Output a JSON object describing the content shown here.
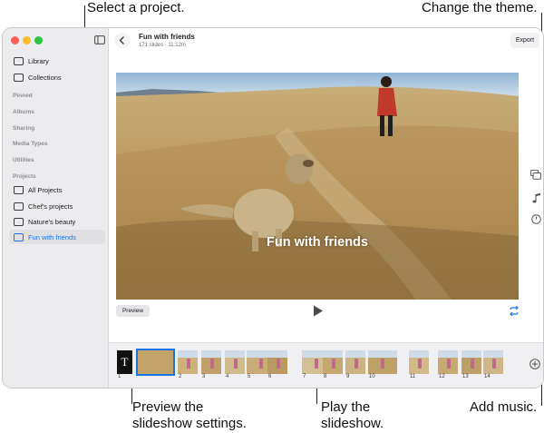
{
  "callouts": {
    "select_project": "Select a project.",
    "change_theme": "Change the theme.",
    "preview_line1": "Preview the",
    "preview_line2": "slideshow settings.",
    "play_line1": "Play the",
    "play_line2": "slideshow.",
    "add_music": "Add music."
  },
  "sidebar": {
    "top_items": [
      {
        "label": "Library",
        "icon": "photo-library-icon"
      },
      {
        "label": "Collections",
        "icon": "collections-icon"
      }
    ],
    "sections": [
      "Pinned",
      "Albums",
      "Sharing",
      "Media Types",
      "Utilities",
      "Projects"
    ],
    "projects": [
      {
        "label": "All Projects",
        "icon": "projects-icon",
        "active": false
      },
      {
        "label": "Chef's projects",
        "icon": "slideshow-icon",
        "active": false
      },
      {
        "label": "Nature's beauty",
        "icon": "slideshow-icon",
        "active": false
      },
      {
        "label": "Fun with friends",
        "icon": "slideshow-icon",
        "active": true
      }
    ]
  },
  "header": {
    "title": "Fun with friends",
    "subtitle": "171 slides · 11:12m",
    "export_label": "Export"
  },
  "slide": {
    "title_text": "Fun with friends"
  },
  "controls": {
    "preview_label": "Preview"
  },
  "filmstrip": {
    "title_card_glyph": "T",
    "frame_numbers": [
      "1",
      "2",
      "3",
      "4",
      "5",
      "6",
      "7",
      "8",
      "9",
      "10",
      "11",
      "12",
      "13",
      "14"
    ]
  },
  "colors": {
    "accent": "#1a73e8",
    "sidebar_bg": "#ececee",
    "close": "#ff5f57",
    "minimize": "#febc2e",
    "zoom": "#28c840"
  }
}
